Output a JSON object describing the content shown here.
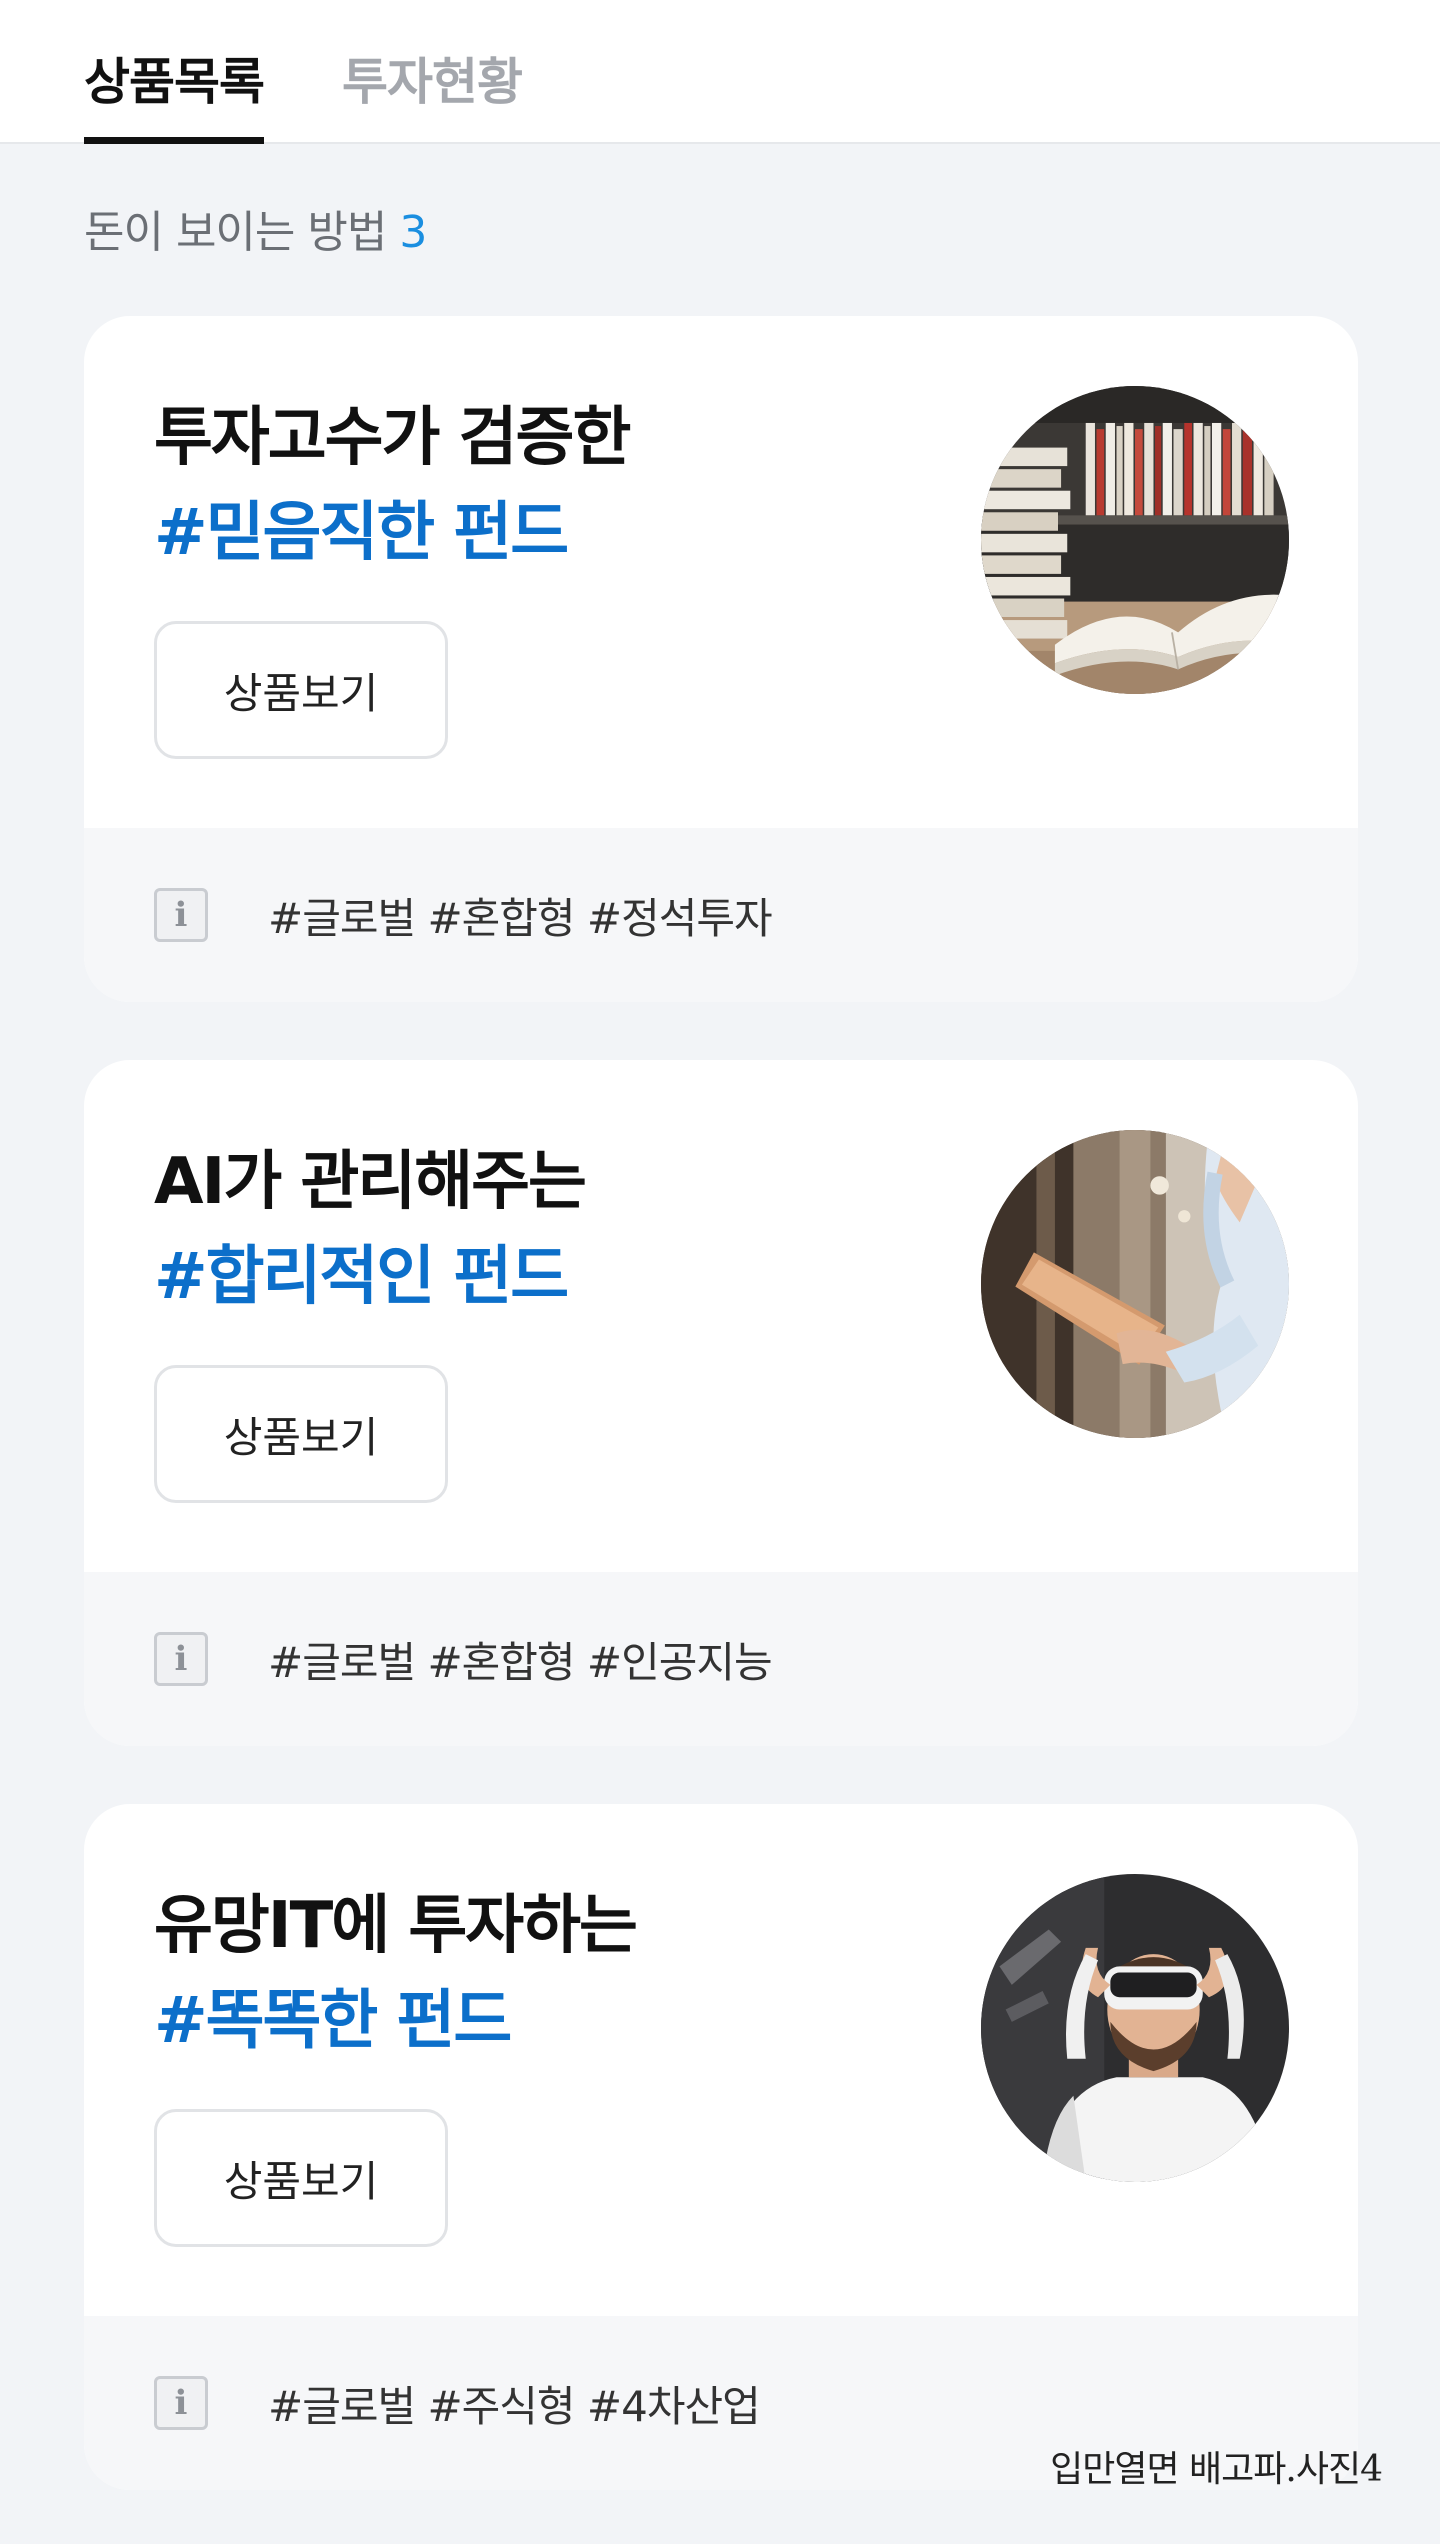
{
  "tabs": [
    {
      "label": "상품목록",
      "active": true
    },
    {
      "label": "투자현황",
      "active": false
    }
  ],
  "section": {
    "title": "돈이 보이는 방법",
    "count": "3"
  },
  "cards": [
    {
      "title_line1": "투자고수가 검증한",
      "title_line2": "#믿음직한 펀드",
      "button_label": "상품보기",
      "tags": "#글로벌 #혼합형 #정석투자",
      "image": "books-photo"
    },
    {
      "title_line1": "AI가 관리해주는",
      "title_line2": "#합리적인 펀드",
      "button_label": "상품보기",
      "tags": "#글로벌 #혼합형 #인공지능",
      "image": "tablet-photo"
    },
    {
      "title_line1": "유망IT에 투자하는",
      "title_line2": "#똑똑한 펀드",
      "button_label": "상품보기",
      "tags": "#글로벌 #주식형 #4차산업",
      "image": "vr-headset-photo"
    }
  ],
  "watermark": "입만열면 배고파.사진4",
  "colors": {
    "accent_blue": "#0c6fca",
    "count_blue": "#1a8ee0",
    "background": "#f2f4f7"
  }
}
